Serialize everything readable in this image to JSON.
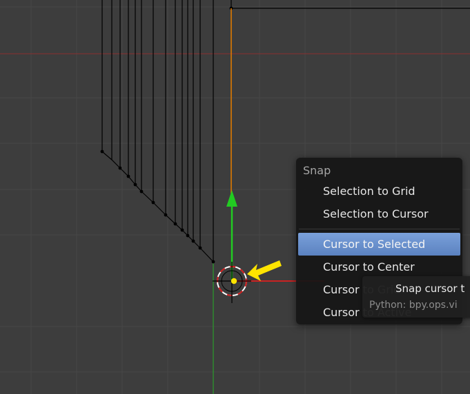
{
  "viewport": {
    "colors": {
      "background": "#3d3d3d",
      "grid": "#474747",
      "x_axis": "#8a3030",
      "y_axis": "#2f8a2f",
      "wire": "#000000",
      "selected_edge": "#e07a00",
      "gizmo_y": "#22cc22",
      "gizmo_x": "#cc2222",
      "annotation_arrow": "#ffe400"
    },
    "icons": [
      "3d-cursor-icon",
      "green-y-gizmo-arrow",
      "yellow-annotation-arrow"
    ]
  },
  "snap_menu": {
    "title": "Snap",
    "items": [
      {
        "label": "Selection to Grid",
        "active": false
      },
      {
        "label": "Selection to Cursor",
        "active": false
      },
      {
        "label": "Cursor to Selected",
        "active": true
      },
      {
        "label": "Cursor to Center",
        "active": false
      },
      {
        "label": "Cursor to Grid",
        "active": false
      },
      {
        "label": "Cursor to Active",
        "active": false
      }
    ]
  },
  "tooltip": {
    "title": "Snap cursor t",
    "python": "Python: bpy.ops.vi"
  }
}
